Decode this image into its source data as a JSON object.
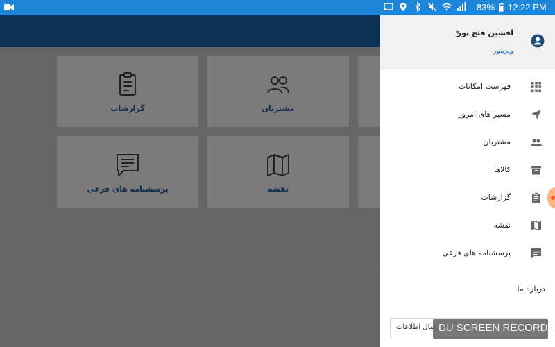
{
  "status_bar": {
    "battery": "83%",
    "time": "12:22 PM"
  },
  "tiles": [
    {
      "label": "گزارشات",
      "icon": "clipboard-icon"
    },
    {
      "label": "مشتریان",
      "icon": "people-icon"
    },
    {
      "label": "پرسشنامه های فرعی",
      "icon": "comment-icon"
    },
    {
      "label": "نقشه",
      "icon": "map-icon"
    }
  ],
  "drawer": {
    "user_name": "افشین فتح پور",
    "user_role": "ویزیتور",
    "menu": [
      {
        "label": "فهرست امکانات",
        "icon": "apps-icon"
      },
      {
        "label": "مسیر های امروز",
        "icon": "navigation-icon"
      },
      {
        "label": "مشتریان",
        "icon": "people-icon"
      },
      {
        "label": "کالاها",
        "icon": "archive-icon"
      },
      {
        "label": "گزارشات",
        "icon": "clipboard-icon"
      },
      {
        "label": "نقشه",
        "icon": "map-icon"
      },
      {
        "label": "پرسشنامه های فرعی",
        "icon": "comment-icon"
      }
    ],
    "about": "درباره ما",
    "sync_button": "ارسال اطلاعات"
  },
  "watermark": "DU SCREEN RECORDER",
  "colors": {
    "status_bar": "#1d86d8",
    "app_bar": "#0e3257",
    "dim_overlay": "#666666",
    "tile": "#7b7b7b",
    "accent": "#1976d2"
  }
}
